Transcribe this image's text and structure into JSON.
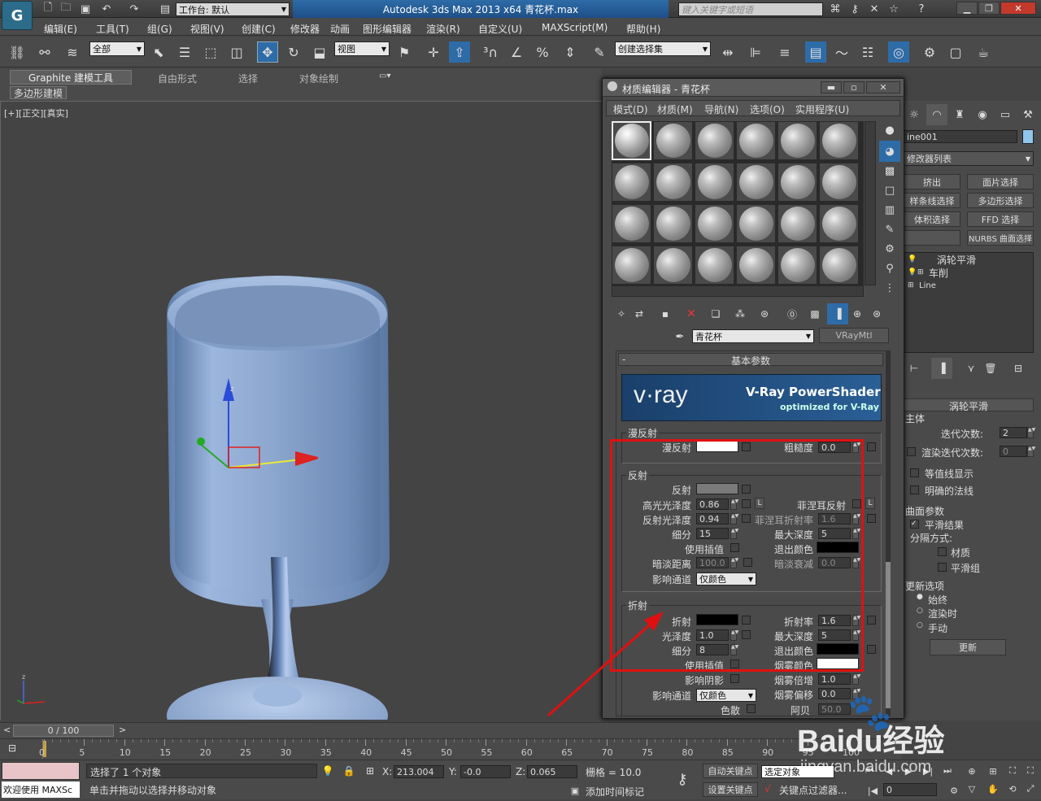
{
  "titlebar": {
    "workspace": "工作台: 默认",
    "title": "Autodesk 3ds Max  2013 x64     青花杯.max",
    "search_placeholder": "键入关键字或短语"
  },
  "menubar": [
    "编辑(E)",
    "工具(T)",
    "组(G)",
    "视图(V)",
    "创建(C)",
    "修改器",
    "动画",
    "图形编辑器",
    "渲染(R)",
    "自定义(U)",
    "MAXScript(M)",
    "帮助(H)"
  ],
  "toolbar": {
    "selection_filter": "全部",
    "ref_coord": "视图",
    "named_selection": "创建选择集"
  },
  "ribbon": {
    "tabs": [
      "Graphite 建模工具",
      "自由形式",
      "选择",
      "对象绘制"
    ],
    "sub": "多边形建模"
  },
  "viewport": {
    "label": "[+][正交][真实]",
    "axis_x": "x",
    "axis_y": "y",
    "axis_z": "z"
  },
  "mat_editor": {
    "title": "材质编辑器 - 青花杯",
    "menu": [
      "模式(D)",
      "材质(M)",
      "导航(N)",
      "选项(O)",
      "实用程序(U)"
    ],
    "material_name": "青花杯",
    "material_type": "VRayMtl",
    "rollout_title": "基本参数",
    "banner_logo": "v·ray",
    "banner_title": "V-Ray PowerShader",
    "banner_sub": "optimized for V-Ray",
    "diffuse": {
      "group": "漫反射",
      "diffuse": "漫反射",
      "roughness": "粗糙度",
      "roughness_val": "0.0"
    },
    "reflect": {
      "group": "反射",
      "reflect": "反射",
      "hilight": "高光光泽度",
      "hilight_val": "0.86",
      "refl_gloss": "反射光泽度",
      "refl_gloss_val": "0.94",
      "subdivs": "细分",
      "subdivs_val": "15",
      "interp": "使用插值",
      "dim_dist": "暗淡距离",
      "dim_dist_val": "100.0",
      "affect": "影响通道",
      "affect_val": "仅颜色",
      "fresnel": "菲涅耳反射",
      "fresnel_ior": "菲涅耳折射率",
      "fresnel_ior_val": "1.6",
      "max_depth": "最大深度",
      "max_depth_val": "5",
      "exit_color": "退出颜色",
      "dim_falloff": "暗淡衰减",
      "dim_falloff_val": "0.0",
      "L": "L"
    },
    "refract": {
      "group": "折射",
      "refract": "折射",
      "gloss": "光泽度",
      "gloss_val": "1.0",
      "subdivs": "细分",
      "subdivs_val": "8",
      "interp": "使用插值",
      "shadows": "影响阴影",
      "affect": "影响通道",
      "affect_val": "仅颜色",
      "dispersion": "色散",
      "ior": "折射率",
      "ior_val": "1.6",
      "max_depth": "最大深度",
      "max_depth_val": "5",
      "exit_color": "退出颜色",
      "fog_color": "烟雾颜色",
      "fog_mult": "烟雾倍增",
      "fog_mult_val": "1.0",
      "fog_bias": "烟雾偏移",
      "fog_bias_val": "0.0",
      "abbe": "阿贝",
      "abbe_val": "50.0"
    }
  },
  "cmdpanel": {
    "obj_name": "ine001",
    "mod_list": "修改器列表",
    "buttons": [
      "挤出",
      "面片选择",
      "样条线选择",
      "多边形选择",
      "体积选择",
      "FFD 选择",
      "",
      "NURBS 曲面选择"
    ],
    "stack": [
      "涡轮平滑",
      "车削",
      "Line"
    ],
    "rollout": "涡轮平滑",
    "main": "主体",
    "iter": "迭代次数:",
    "iter_val": "2",
    "render_iter": "渲染迭代次数:",
    "render_iter_val": "0",
    "isoline": "等值线显示",
    "explicit": "明确的法线",
    "surface": "曲面参数",
    "smooth": "平滑结果",
    "sep": "分隔方式:",
    "materials": "材质",
    "smoothgroups": "平滑组",
    "update_opts": "更新选项",
    "always": "始终",
    "when_render": "渲染时",
    "manual": "手动",
    "update": "更新"
  },
  "timeline": {
    "frame": "0 / 100",
    "ticks": [
      "0",
      "5",
      "10",
      "15",
      "20",
      "25",
      "30",
      "35",
      "40",
      "45",
      "50",
      "55",
      "60",
      "65",
      "70",
      "75",
      "80",
      "85",
      "90",
      "95",
      "100"
    ]
  },
  "status": {
    "welcome": "欢迎使用 MAXSc",
    "selected": "选择了 1 个对象",
    "hint": "单击并拖动以选择并移动对象",
    "x": "213.004",
    "y": "-0.0",
    "z": "0.065",
    "grid": "栅格 = 10.0",
    "add_time_tag": "添加时间标记",
    "auto_key": "自动关键点",
    "set_key": "设置关键点",
    "sel_obj": "选定对象",
    "key_filters": "关键点过滤器...",
    "frame_val": "0",
    "xl": "X:",
    "yl": "Y:",
    "zl": "Z:"
  },
  "watermark": "Baidu经验",
  "watermark_url": "jingyan.baidu.com"
}
